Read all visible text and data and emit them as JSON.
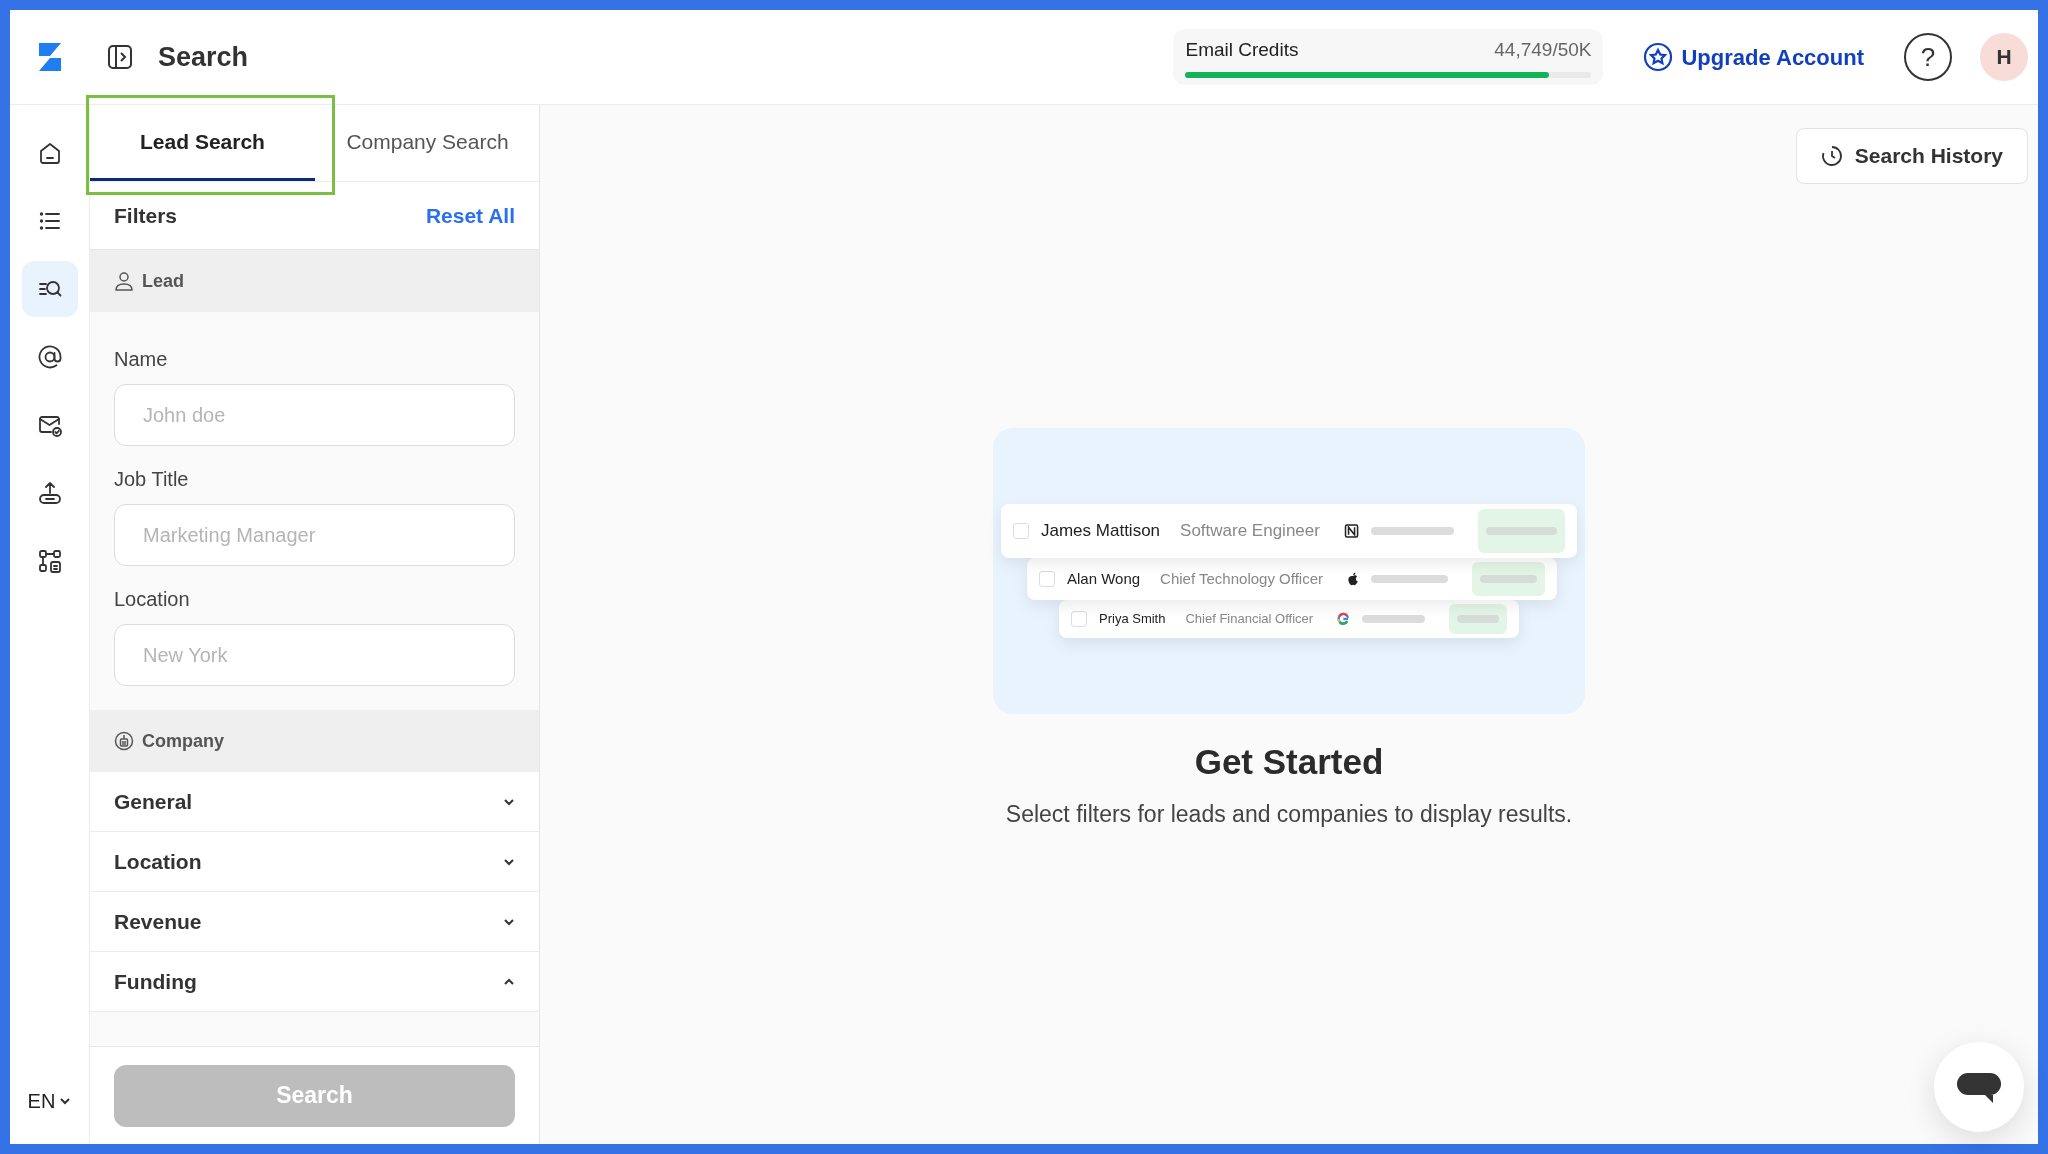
{
  "header": {
    "title": "Search",
    "credits": {
      "label": "Email Credits",
      "reading": "44,749/50K",
      "level": 0.895
    },
    "upgrade": "Upgrade Account",
    "help": "?",
    "avatar": "H"
  },
  "nav_items": [
    {
      "kind": "home",
      "selected": false
    },
    {
      "kind": "list",
      "selected": false
    },
    {
      "kind": "search",
      "selected": true
    },
    {
      "kind": "at",
      "selected": false
    },
    {
      "kind": "mail",
      "selected": false
    },
    {
      "kind": "upload",
      "selected": false
    },
    {
      "kind": "flow",
      "selected": false
    }
  ],
  "language": "EN",
  "tabs": [
    {
      "label": "Lead Search",
      "selected": true,
      "highlighted": true
    },
    {
      "label": "Company Search",
      "selected": false,
      "highlighted": false
    }
  ],
  "filters": {
    "title": "Filters",
    "reset": "Reset All",
    "lead_section": {
      "label": "Lead",
      "fields": [
        {
          "label": "Name",
          "placeholder": "John doe"
        },
        {
          "label": "Job Title",
          "placeholder": "Marketing Manager"
        },
        {
          "label": "Location",
          "placeholder": "New York"
        }
      ]
    },
    "company_section": {
      "label": "Company",
      "groups": [
        {
          "label": "General",
          "expanded": false
        },
        {
          "label": "Location",
          "expanded": false
        },
        {
          "label": "Revenue",
          "expanded": false
        },
        {
          "label": "Funding",
          "expanded": true
        }
      ]
    },
    "search_button": {
      "label": "Search",
      "disabled": true
    }
  },
  "search_history": "Search History",
  "illustration": {
    "rows": [
      {
        "name": "James Mattison",
        "title": "Software Engineer",
        "kind": "notion",
        "checked": false
      },
      {
        "name": "Alan Wong",
        "title": "Chief Technology Officer",
        "kind": "apple",
        "checked": false
      },
      {
        "name": "Priya Smith",
        "title": "Chief Financial Officer",
        "kind": "google",
        "checked": false
      }
    ]
  },
  "empty_state": {
    "title": "Get Started",
    "message": "Select filters for leads and companies to display results."
  }
}
